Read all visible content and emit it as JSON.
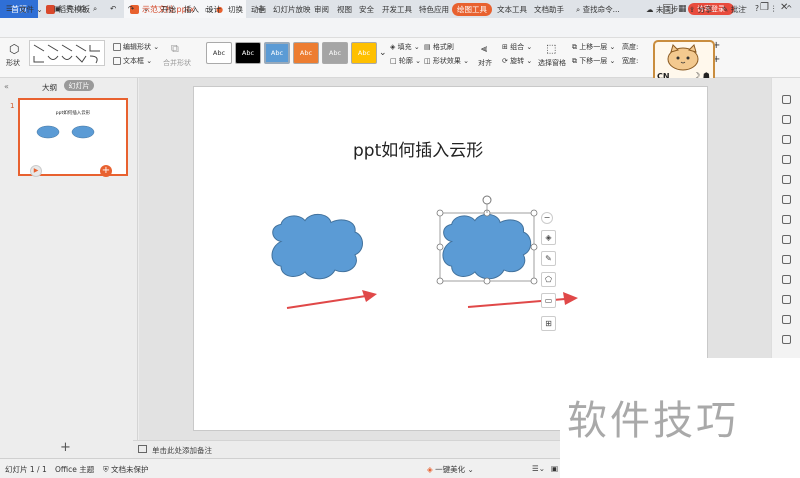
{
  "titlebar": {
    "tabs": [
      {
        "label": "首页"
      },
      {
        "label": "稻壳模板"
      },
      {
        "label": "示范文档.pptx"
      }
    ],
    "page_count": "1",
    "login_label": "访客登录"
  },
  "menubar": {
    "file_label": "文件",
    "items": [
      "开始",
      "插入",
      "设计",
      "切换",
      "动画",
      "幻灯片放映",
      "审阅",
      "视图",
      "安全",
      "开发工具",
      "特色应用",
      "绘图工具",
      "文本工具",
      "文档助手"
    ],
    "search_label": "查找命令...",
    "sync_label": "未同步",
    "share_label": "分享",
    "comment_label": "批注"
  },
  "ribbon": {
    "shape_label": "形状",
    "edit_shape_label": "编辑形状",
    "textbox_label": "文本框",
    "merge_label": "合并形状",
    "style_swatches": [
      {
        "label": "Abc",
        "bg": "#ffffff",
        "fg": "#333333"
      },
      {
        "label": "Abc",
        "bg": "#000000",
        "fg": "#ffffff"
      },
      {
        "label": "Abc",
        "bg": "#5b9bd5",
        "fg": "#ffffff"
      },
      {
        "label": "Abc",
        "bg": "#ed7d31",
        "fg": "#ffffff"
      },
      {
        "label": "Abc",
        "bg": "#a5a5a5",
        "fg": "#ffffff"
      },
      {
        "label": "Abc",
        "bg": "#ffc000",
        "fg": "#ffffff"
      }
    ],
    "fill_label": "填充",
    "format_brush_label": "格式刷",
    "outline_label": "轮廓",
    "shape_effect_label": "形状效果",
    "align_label": "对齐",
    "group_label": "组合",
    "rotate_label": "旋转",
    "select_pane_label": "选择窗格",
    "bring_forward_label": "上移一层",
    "send_backward_label": "下移一层",
    "height_label": "高度:",
    "width_label": "宽度:"
  },
  "panel": {
    "outline_tab": "大纲",
    "slides_tab": "幻灯片",
    "slide_number": "1",
    "thumb_title": "ppt如何插入云形"
  },
  "slide": {
    "title": "ppt如何插入云形",
    "cloud_color": "#5b9bd5",
    "arrow_color": "#e04848"
  },
  "notes": {
    "placeholder": "单击此处添加备注"
  },
  "statusbar": {
    "slide_info": "幻灯片 1 / 1",
    "theme": "Office 主题",
    "protect": "文档未保护",
    "beautify": "一键美化"
  },
  "badge": {
    "label": "CN"
  },
  "watermark": {
    "text": "软件技巧"
  }
}
